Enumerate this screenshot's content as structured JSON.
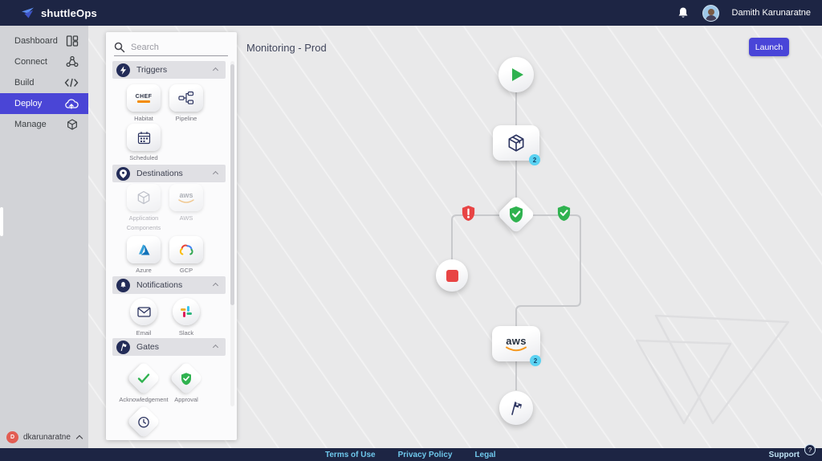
{
  "topbar": {
    "logo": "shuttleOps",
    "user_name": "Damith Karunaratne"
  },
  "sidebar": {
    "items": [
      {
        "label": "Dashboard"
      },
      {
        "label": "Connect"
      },
      {
        "label": "Build"
      },
      {
        "label": "Deploy"
      },
      {
        "label": "Manage"
      }
    ],
    "footer_initial": "D",
    "footer_user": "dkarunaratne"
  },
  "palette": {
    "search_placeholder": "Search",
    "sections": [
      {
        "label": "Triggers",
        "items": [
          {
            "label": "Habitat",
            "logo_text": "CHEF"
          },
          {
            "label": "Pipeline"
          },
          {
            "label": "Scheduled"
          }
        ]
      },
      {
        "label": "Destinations",
        "items": [
          {
            "label": "Application Components"
          },
          {
            "label": "AWS",
            "logo_text": "aws"
          },
          {
            "label": "Azure"
          },
          {
            "label": "GCP"
          }
        ]
      },
      {
        "label": "Notifications",
        "items": [
          {
            "label": "Email"
          },
          {
            "label": "Slack"
          }
        ]
      },
      {
        "label": "Gates",
        "items": [
          {
            "label": "Acknowledgement"
          },
          {
            "label": "Approval"
          }
        ]
      }
    ]
  },
  "canvas": {
    "title": "Monitoring - Prod",
    "launch_button": "Launch",
    "nodes": {
      "package_badge": "2",
      "aws_label": "aws",
      "aws_badge": "2"
    }
  },
  "footer": {
    "links": [
      {
        "label": "Terms of Use"
      },
      {
        "label": "Privacy Policy"
      },
      {
        "label": "Legal"
      }
    ],
    "support": "Support",
    "help": "?"
  },
  "colors": {
    "navy": "#1d2544",
    "accent": "#4945d8",
    "green": "#2fb24f",
    "red": "#e84444",
    "badge_cyan": "#5ad2f2"
  }
}
